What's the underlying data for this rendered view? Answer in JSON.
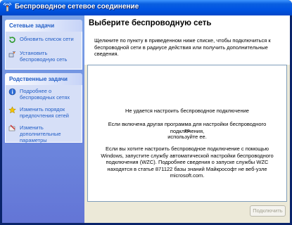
{
  "window": {
    "title": "Беспроводное сетевое соединение",
    "icon": "wireless-network-icon"
  },
  "sidebar": {
    "network_tasks": {
      "header": "Сетевые задачи",
      "items": [
        {
          "label": "Обновить список сети",
          "icon": "refresh-icon"
        },
        {
          "label": "Установить беспроводную сеть",
          "icon": "wireless-setup-icon"
        }
      ]
    },
    "related_tasks": {
      "header": "Родственные задачи",
      "items": [
        {
          "label": "Подробнее о беспроводных сетях",
          "icon": "info-icon"
        },
        {
          "label": "Изменить порядок предпочтения сетей",
          "icon": "star-icon"
        },
        {
          "label": "Изменить дополнительные параметры",
          "icon": "settings-icon"
        }
      ]
    }
  },
  "main": {
    "title": "Выберите беспроводную сеть",
    "description": "Щелкните по пункту в приведенном ниже списке, чтобы подключиться к беспроводной сети в радиусе действия или получить дополнительные сведения.",
    "messages": {
      "cannot_configure": "Не удается настроить беспроводное подключение",
      "other_program_1": "Если включена другая программа для настройки беспроводного подключения,",
      "other_program_2": "то",
      "other_program_3": "используйте ее.",
      "use_windows": "Если вы хотите настроить беспроводное подключение с помощью Windows, запустите службу автоматической настройки беспроводного подключения (WZC). Подробнее сведения о запуске службы WZC находятся в статье 871122 базы знаний Майкрософт не веб-узле microsoft.com."
    },
    "connect_label": "Подключить"
  },
  "colors": {
    "titlebar": "#0054e3",
    "taskpane": "#6375d6",
    "link": "#215dc6"
  }
}
